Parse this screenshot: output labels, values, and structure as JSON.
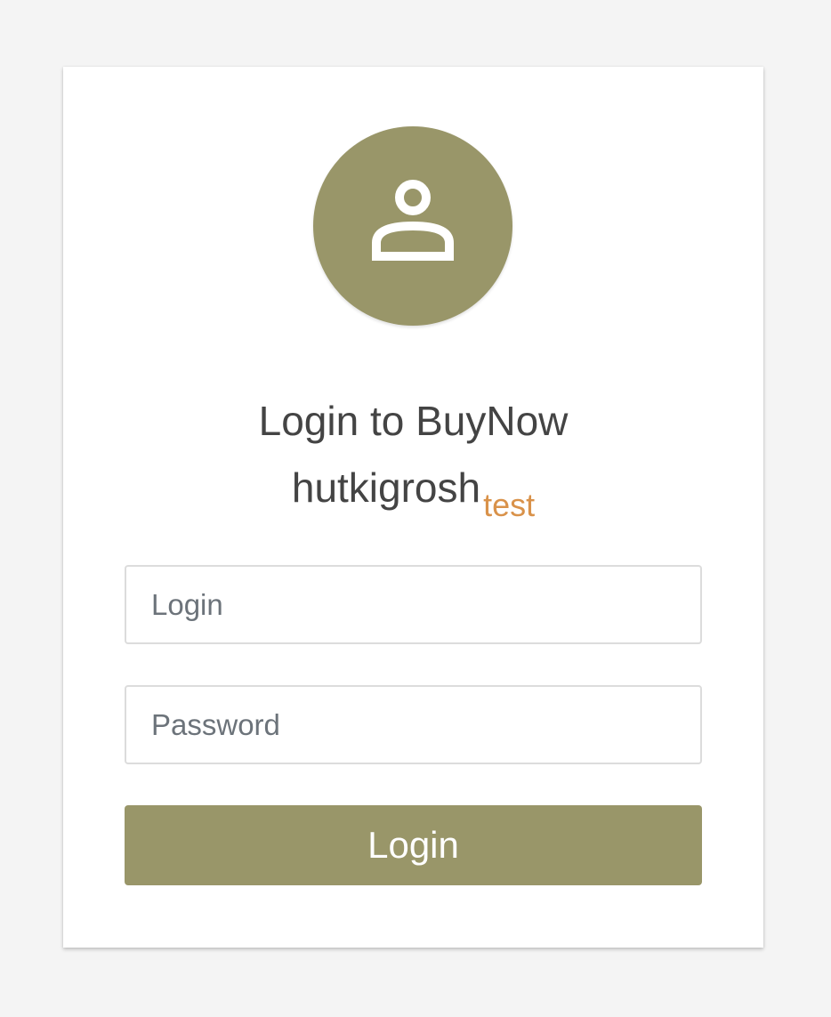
{
  "login_card": {
    "title": "Login to BuyNow",
    "subtitle_brand": "hutkigrosh",
    "subtitle_env": "test",
    "login_field": {
      "placeholder": "Login",
      "value": ""
    },
    "password_field": {
      "placeholder": "Password",
      "value": ""
    },
    "submit_label": "Login",
    "avatar_icon": "user-icon"
  },
  "colors": {
    "accent": "#999669",
    "env_badge": "#d9924a",
    "text": "#444444",
    "background": "#f4f4f4"
  }
}
